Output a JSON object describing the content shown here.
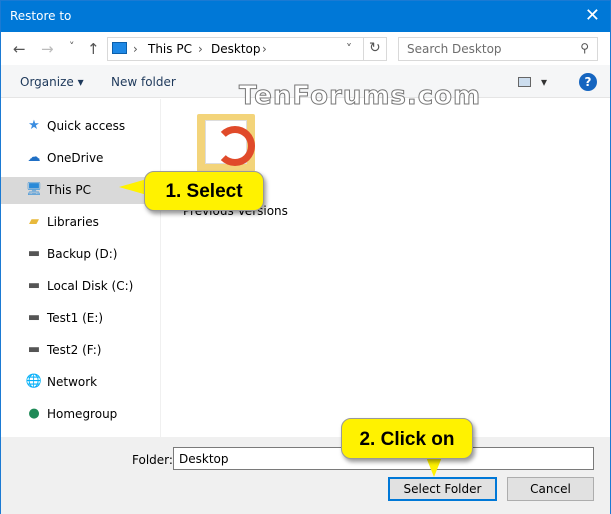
{
  "window": {
    "title": "Restore to",
    "close": "✕"
  },
  "nav": {
    "back": "←",
    "forward": "→",
    "recent": "˅",
    "up": "↑",
    "refresh": "↻",
    "dropdown": "˅",
    "breadcrumb": [
      "This PC",
      "Desktop"
    ],
    "sep": "›",
    "search_placeholder": "Search Desktop",
    "search_icon": "⚲"
  },
  "toolbar": {
    "organize": "Organize ▾",
    "new_folder": "New folder",
    "view": "▾",
    "help": "?"
  },
  "watermark": "TenForums.com",
  "sidebar": {
    "items": [
      {
        "label": "Quick access",
        "icon": "★",
        "color": "#3a8de0"
      },
      {
        "label": "OneDrive",
        "icon": "☁",
        "color": "#1f6fc5"
      },
      {
        "label": "This PC",
        "icon": "🖥",
        "color": "#2a8ad8"
      },
      {
        "label": "Libraries",
        "icon": "▰",
        "color": "#e8b93c"
      },
      {
        "label": "Backup (D:)",
        "icon": "▬",
        "color": "#555"
      },
      {
        "label": "Local Disk (C:)",
        "icon": "▬",
        "color": "#555"
      },
      {
        "label": "Test1 (E:)",
        "icon": "▬",
        "color": "#555"
      },
      {
        "label": "Test2 (F:)",
        "icon": "▬",
        "color": "#555"
      },
      {
        "label": "Network",
        "icon": "🌐",
        "color": "#2a7ad0"
      },
      {
        "label": "Homegroup",
        "icon": "●",
        "color": "#1f8a57"
      }
    ]
  },
  "content": {
    "items": [
      {
        "label": "Previous Versions"
      }
    ]
  },
  "footer": {
    "folder_label": "Folder:",
    "folder_value": "Desktop",
    "select": "Select Folder",
    "cancel": "Cancel"
  },
  "callouts": {
    "first": "1. Select",
    "second": "2. Click on"
  }
}
